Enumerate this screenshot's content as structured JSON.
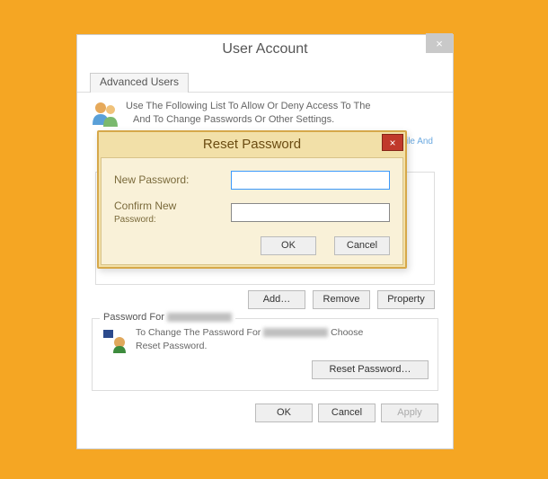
{
  "main": {
    "title": "User Account",
    "close_glyph": "×",
    "tab_label": "Advanced Users",
    "info_line1": "Use The Following List To Allow Or Deny Access To The",
    "info_line2": "And To Change Passwords Or Other Settings.",
    "link_line": "ile And",
    "add_label": "Add…",
    "remove_label": "Remove",
    "property_label": "Property",
    "group_title": "Password For",
    "pw_line_prefix": "To Change The Password For",
    "pw_line_suffix": "Choose",
    "pw_line2": "Reset Password.",
    "reset_btn_label": "Reset Password…",
    "ok_label": "OK",
    "cancel_label": "Cancel",
    "apply_label": "Apply"
  },
  "modal": {
    "title": "Reset Password",
    "close_glyph": "×",
    "new_password_label": "New Password:",
    "confirm_label_line1": "Confirm New",
    "confirm_label_line2": "Password:",
    "new_password_value": "",
    "confirm_value": "",
    "ok_label": "OK",
    "cancel_label": "Cancel"
  }
}
